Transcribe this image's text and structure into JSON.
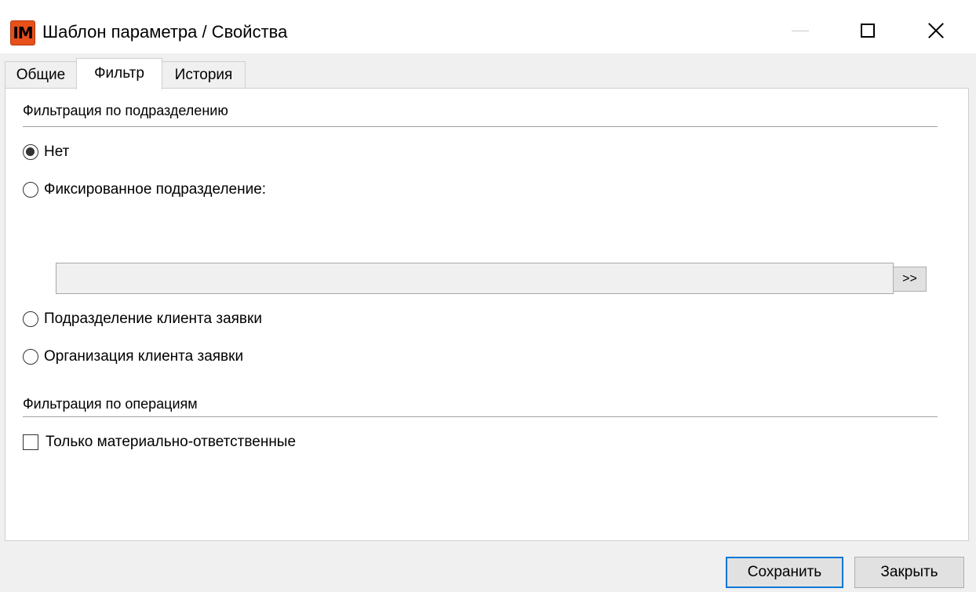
{
  "window": {
    "icon_text": "IM",
    "title": "Шаблон параметра / Свойства"
  },
  "tabs": [
    {
      "label": "Общие",
      "active": false
    },
    {
      "label": "Фильтр",
      "active": true
    },
    {
      "label": "История",
      "active": false
    }
  ],
  "filter_by_department": {
    "title": "Фильтрация по подразделению",
    "options": [
      {
        "label": "Нет",
        "checked": true
      },
      {
        "label": "Фиксированное подразделение:",
        "checked": false
      },
      {
        "label": "Подразделение клиента заявки",
        "checked": false
      },
      {
        "label": "Организация клиента заявки",
        "checked": false
      }
    ],
    "fixed_department_value": "",
    "browse_label": ">>"
  },
  "filter_by_operations": {
    "title": "Фильтрация по операциям",
    "checkbox_label": "Только материально-ответственные",
    "checkbox_checked": false
  },
  "buttons": {
    "save": "Сохранить",
    "close": "Закрыть"
  },
  "colors": {
    "accent": "#0078d7",
    "icon": "#e8501a"
  }
}
